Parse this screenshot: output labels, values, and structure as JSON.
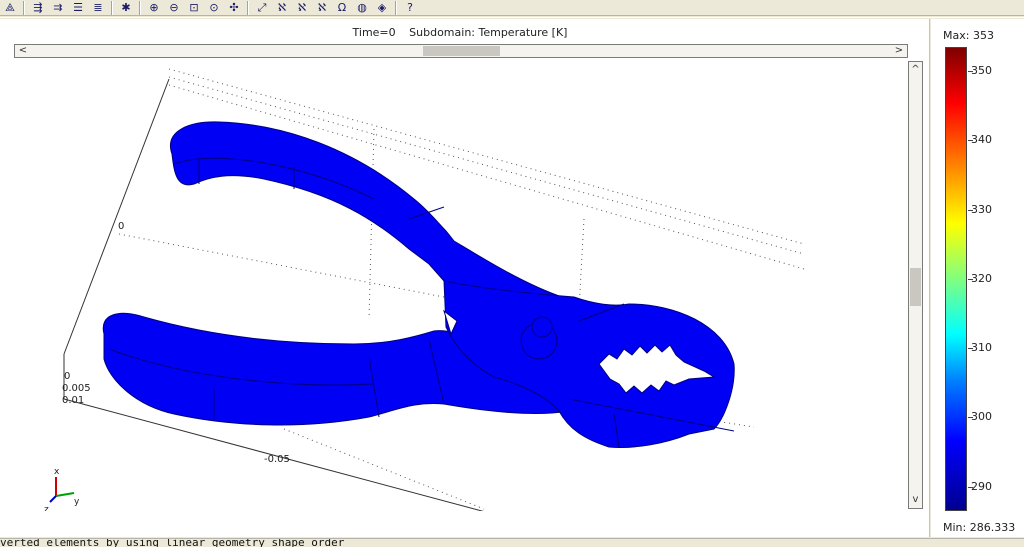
{
  "toolbar": {
    "buttons": [
      {
        "name": "axis-triangle-icon",
        "glyph": "⟁"
      },
      {
        "name": "draw-mode-icon",
        "glyph": "⇶"
      },
      {
        "name": "point-mode-icon",
        "glyph": "⇉"
      },
      {
        "name": "lines-icon",
        "glyph": "☰"
      },
      {
        "name": "lines-underlined-icon",
        "glyph": "≣"
      },
      {
        "name": "plot-settings-icon",
        "glyph": "✱"
      },
      {
        "name": "zoom-in-icon",
        "glyph": "⊕"
      },
      {
        "name": "zoom-out-icon",
        "glyph": "⊖"
      },
      {
        "name": "zoom-window-icon",
        "glyph": "⊡"
      },
      {
        "name": "zoom-extents-icon",
        "glyph": "⊙"
      },
      {
        "name": "pan-icon",
        "glyph": "✣"
      },
      {
        "name": "select-subdomain-icon",
        "glyph": "⤢"
      },
      {
        "name": "ab-boundary-icon",
        "glyph": "ℵ"
      },
      {
        "name": "ab-edge-icon",
        "glyph": "ℵ"
      },
      {
        "name": "ab-point-icon",
        "glyph": "ℵ"
      },
      {
        "name": "omega-icon",
        "glyph": "Ω"
      },
      {
        "name": "sphere-icon",
        "glyph": "◍"
      },
      {
        "name": "render-icon",
        "glyph": "◈"
      },
      {
        "name": "help-icon",
        "glyph": "?"
      }
    ]
  },
  "plot": {
    "time_label": "Time=0",
    "subdomain_label": "Subdomain: Temperature [K]",
    "axis_labels": {
      "y_zero": "0",
      "z_0": "0",
      "z_005": "0.005",
      "z_01": "0.01",
      "x_neg005": "-0.05",
      "x_zero": "0"
    },
    "triad": {
      "x": "x",
      "y": "y",
      "z": "z"
    },
    "fill_color": "#0000f4",
    "edge_color": "#000080"
  },
  "colorbar": {
    "max_label": "Max: 353",
    "min_label": "Min: 286.333",
    "ticks": [
      "350",
      "340",
      "330",
      "320",
      "310",
      "300",
      "290"
    ],
    "colors": [
      "#7f0000",
      "#ff0000",
      "#ff8000",
      "#ffff00",
      "#80ff80",
      "#00ffff",
      "#0080ff",
      "#0000ff",
      "#00008f"
    ]
  },
  "status": {
    "text": "verted elements by using linear geometry shape order"
  }
}
